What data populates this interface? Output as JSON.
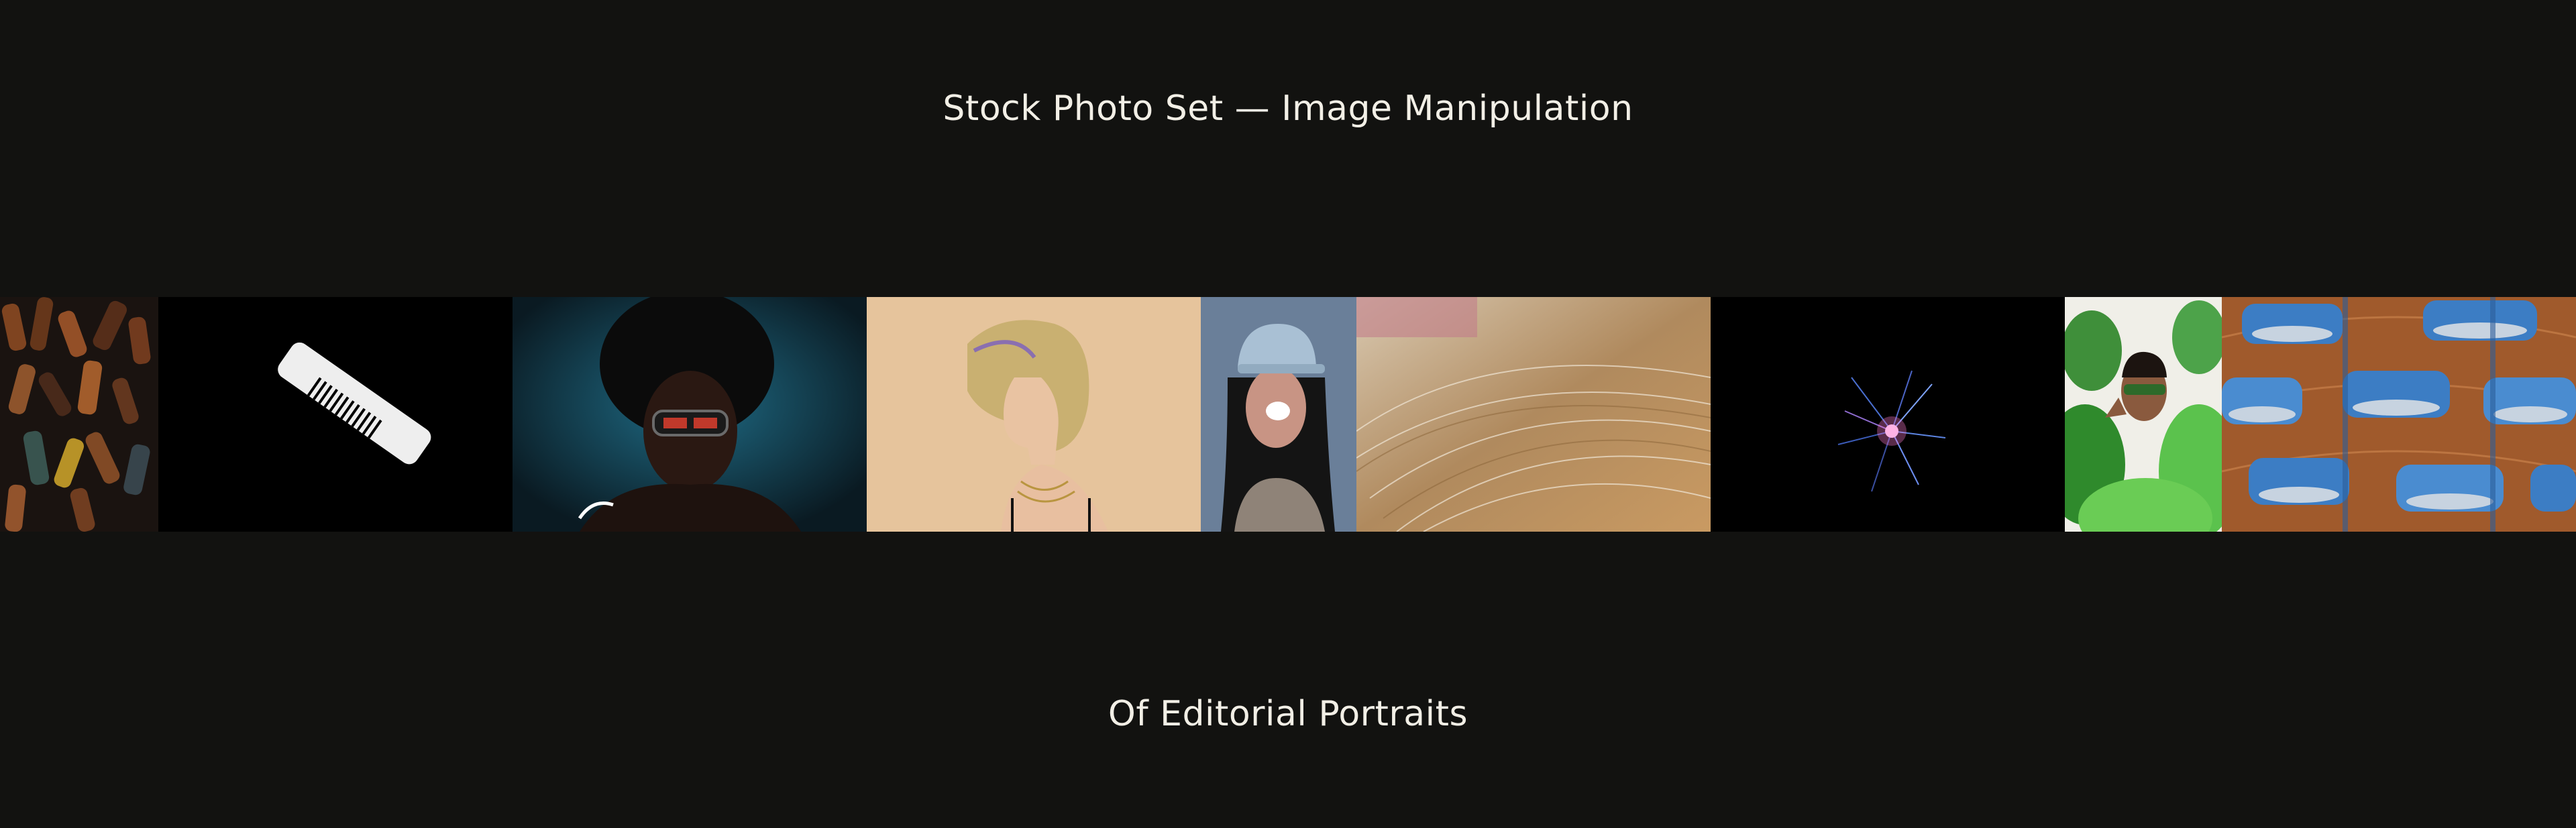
{
  "header": {
    "title": "Stock Photo Set — Image Manipulation"
  },
  "footer": {
    "subtitle": "Of Editorial Portraits"
  },
  "strip": {
    "photos": [
      {
        "subject": "hair-curlers-dark"
      },
      {
        "subject": "white-comb"
      },
      {
        "subject": "afro-portrait-sunglasses"
      },
      {
        "subject": "blonde-profile-portrait"
      },
      {
        "subject": "woman-cap-portrait"
      },
      {
        "subject": "hair-closeup"
      },
      {
        "subject": "sparkler"
      },
      {
        "subject": "woman-plants-portrait"
      },
      {
        "subject": "hair-rollers"
      }
    ]
  }
}
